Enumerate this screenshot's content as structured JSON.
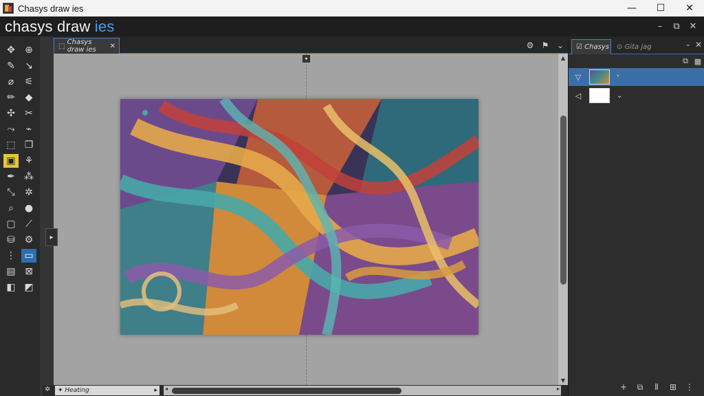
{
  "titlebar": {
    "title": "Chasys draw ies",
    "controls": [
      "—",
      "☐",
      "✕"
    ]
  },
  "brand": {
    "name": "chasys draw ",
    "accent": "ies"
  },
  "mdi_controls": [
    "–",
    "⧉",
    "✕"
  ],
  "tools": [
    "✥",
    "⊕",
    "✎",
    "↘",
    "⌀",
    "⚟",
    "✏",
    "◆",
    "✣",
    "✂",
    "⤳",
    "⌁",
    "⬚",
    "❐",
    "▣",
    "⚘",
    "✒",
    "⁂",
    "⤡",
    "✲",
    "⌕",
    "●",
    "▢",
    "⟋",
    "⛁",
    "⚙",
    "⋮",
    "▭",
    "▤",
    "⊠",
    "◧",
    "◩"
  ],
  "document": {
    "tab_label": "Chasys draw ies",
    "close": "✕"
  },
  "tab_icons": [
    "⚙",
    "⚑",
    "⌄"
  ],
  "statusbar": {
    "zoom_label": "Heating",
    "zoom_arrow": "▸",
    "status_icon": "✲"
  },
  "layers_panel": {
    "active_tab": "Chasys",
    "inactive_tab": "Gita jag",
    "tool_icons": [
      "⧉",
      "▦"
    ],
    "layers": [
      {
        "vis": "▽",
        "chev": "ᵛ"
      },
      {
        "vis": "◁",
        "chev": "⌄"
      }
    ],
    "bottom_icons": [
      "+",
      "⧉",
      "⫴",
      "⊞",
      "⋮"
    ]
  },
  "colors": {
    "accent": "#3c6ea6",
    "tool_highlight": "#e3c63c",
    "workspace": "#a3a3a3"
  }
}
